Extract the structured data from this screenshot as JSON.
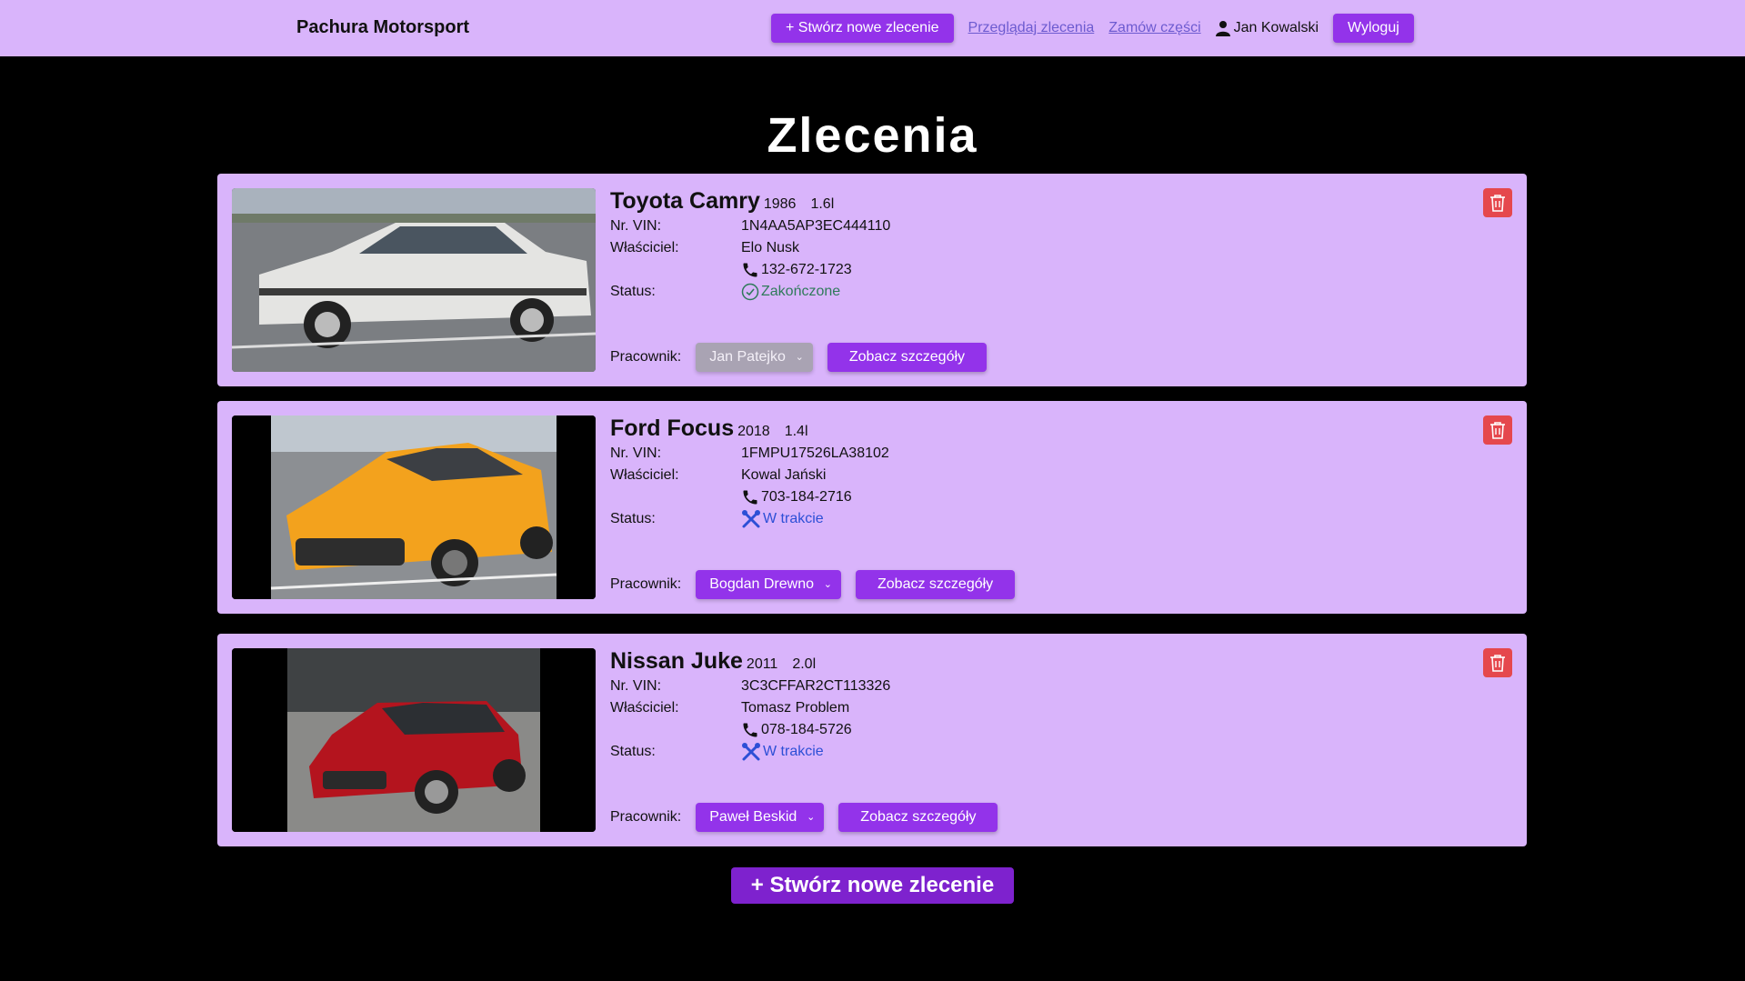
{
  "navbar": {
    "brand": "Pachura Motorsport",
    "create_button": "+ Stwórz nowe zlecenie",
    "browse_link": "Przeglądaj zlecenia",
    "order_parts_link": "Zamów części",
    "user_name": "Jan Kowalski",
    "logout_button": "Wyloguj"
  },
  "page": {
    "title": "Zlecenia"
  },
  "labels": {
    "vin": "Nr. VIN:",
    "owner": "Właściciel:",
    "status": "Status:",
    "worker": "Pracownik:",
    "details_button": "Zobacz szczegóły"
  },
  "orders": [
    {
      "name": "Toyota Camry",
      "year": "1986",
      "engine": "1.6l",
      "vin": "1N4AA5AP3EC444110",
      "owner": "Elo Nusk",
      "phone": "132-672-1723",
      "status": "Zakończone",
      "status_icon": "check-circle-icon",
      "worker": "Jan Patejko",
      "worker_select_disabled": true,
      "car_color": "#e4e4e2"
    },
    {
      "name": "Ford Focus",
      "year": "2018",
      "engine": "1.4l",
      "vin": "1FMPU17526LA38102",
      "owner": "Kowal Jański",
      "phone": "703-184-2716",
      "status": "W trakcie",
      "status_icon": "wrench-screwdriver-icon",
      "worker": "Bogdan Drewno",
      "worker_select_disabled": false,
      "car_color": "#f3a21d"
    },
    {
      "name": "Nissan Juke",
      "year": "2011",
      "engine": "2.0l",
      "vin": "3C3CFFAR2CT113326",
      "owner": "Tomasz Problem",
      "phone": "078-184-5726",
      "status": "W trakcie",
      "status_icon": "wrench-screwdriver-icon",
      "worker": "Paweł Beskid",
      "worker_select_disabled": false,
      "car_color": "#b4141e"
    }
  ],
  "bottom_create_button": "+ Stwórz nowe zlecenie",
  "colors": {
    "navbar_bg": "#d9b4fb",
    "card_bg": "#d9b4fb",
    "accent": "#9333ea",
    "delete": "#e5484d",
    "status_done": "#2f7a5a",
    "status_progress": "#2d4fd6"
  }
}
